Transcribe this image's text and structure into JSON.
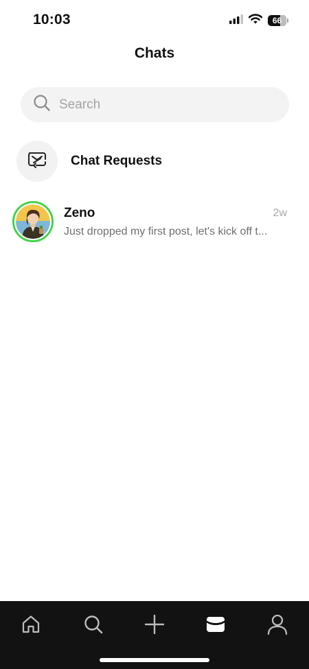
{
  "status_bar": {
    "time": "10:03",
    "battery_level": "66",
    "icons": [
      "cellular-signal-icon",
      "wifi-icon",
      "battery-icon"
    ]
  },
  "header": {
    "title": "Chats"
  },
  "search": {
    "placeholder": "Search",
    "value": ""
  },
  "chat_requests": {
    "label": "Chat Requests",
    "icon": "chat-request-icon"
  },
  "chats": [
    {
      "name": "Zeno",
      "time": "2w",
      "preview": "Just dropped my first post, let's kick off t...",
      "avatar": "avatar-image",
      "ring_color": "#44d34b"
    }
  ],
  "tab_bar": {
    "items": [
      {
        "icon": "home-icon",
        "active": false
      },
      {
        "icon": "search-icon",
        "active": false
      },
      {
        "icon": "plus-icon",
        "active": false
      },
      {
        "icon": "inbox-icon",
        "active": true
      },
      {
        "icon": "profile-icon",
        "active": false
      }
    ]
  },
  "colors": {
    "accent_ring": "#44d34b",
    "tab_bar_bg": "#121212",
    "search_bg": "#f3f3f3"
  }
}
